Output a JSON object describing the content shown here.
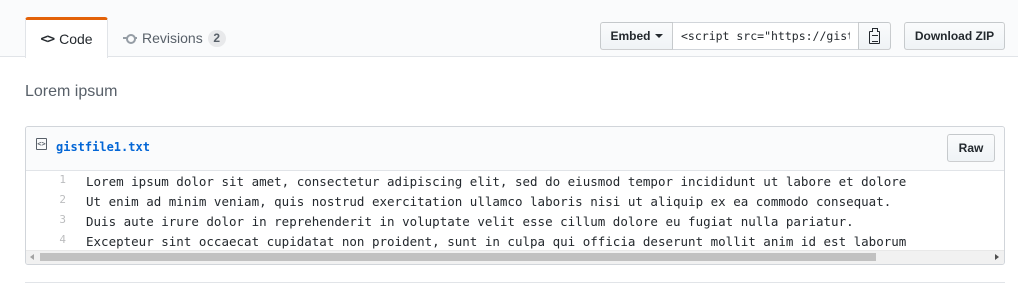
{
  "tabs": {
    "code_label": "Code",
    "code_icon": "<>",
    "revisions_label": "Revisions",
    "revisions_count": "2"
  },
  "embed": {
    "button_label": "Embed",
    "input_value": "<script src=\"https://gist.github.com/"
  },
  "download": {
    "label": "Download ZIP"
  },
  "description": "Lorem ipsum",
  "file": {
    "name": "gistfile1.txt",
    "raw_label": "Raw",
    "lines": [
      {
        "num": "1",
        "text": "Lorem ipsum dolor sit amet, consectetur adipiscing elit, sed do eiusmod tempor incididunt ut labore et dolore"
      },
      {
        "num": "2",
        "text": "Ut enim ad minim veniam, quis nostrud exercitation ullamco laboris nisi ut aliquip ex ea commodo consequat."
      },
      {
        "num": "3",
        "text": "Duis aute irure dolor in reprehenderit in voluptate velit esse cillum dolore eu fugiat nulla pariatur."
      },
      {
        "num": "4",
        "text": "Excepteur sint occaecat cupidatat non proident, sunt in culpa qui officia deserunt mollit anim id est laborum"
      }
    ],
    "scroll_position": 0,
    "scroll_visible_fraction": 0.88
  },
  "colors": {
    "active_tab_accent": "#e36209",
    "link": "#0366d6"
  }
}
